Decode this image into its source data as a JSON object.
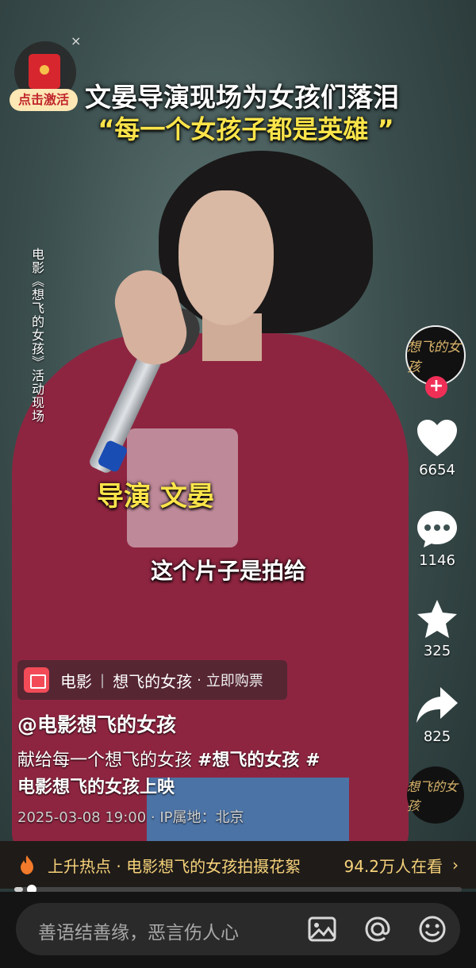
{
  "video": {
    "title_line1": "文晏导演现场为女孩们落泪",
    "title_line2": "“每一个女孩子都是英雄 ”",
    "side_caption": "电影《想飞的女孩》活动现场",
    "director_caption": "导演  文晏",
    "subtitle_caption": "这个片子是拍给"
  },
  "promo": {
    "close_label": "×",
    "activate_label": "点击激活"
  },
  "rail": {
    "avatar_text": "想飞的女孩",
    "follow_label": "+",
    "likes": "6654",
    "comments": "1146",
    "favorites": "325",
    "shares": "825",
    "music_text": "想飞的女孩"
  },
  "info": {
    "anchor_category": "电影",
    "anchor_title": "想飞的女孩",
    "anchor_sep": "|",
    "anchor_dot": "·",
    "anchor_action": "立即购票",
    "author": "@电影想飞的女孩",
    "desc_plain": "献给每一个想飞的女孩 ",
    "desc_tag1": "#想飞的女孩 #",
    "desc_tag2": "电影想飞的女孩上映",
    "meta": "2025-03-08 19:00 · IP属地：北京"
  },
  "hot": {
    "text": "上升热点 · 电影想飞的女孩拍摄花絮",
    "count": "94.2万人在看",
    "chevron": "›"
  },
  "progress": {
    "fraction": 0.02
  },
  "comment_bar": {
    "placeholder": "善语结善缘，恶言伤人心"
  },
  "colors": {
    "accent_red": "#f02f57",
    "title_yellow": "#fbe44a",
    "hoodie": "#8e2540",
    "hot_gold": "#f6d27a"
  },
  "icons": [
    "heart-icon",
    "comment-icon",
    "star-icon",
    "share-icon",
    "flame-icon",
    "image-icon",
    "at-icon",
    "emoji-icon",
    "red-packet-icon",
    "close-icon"
  ]
}
